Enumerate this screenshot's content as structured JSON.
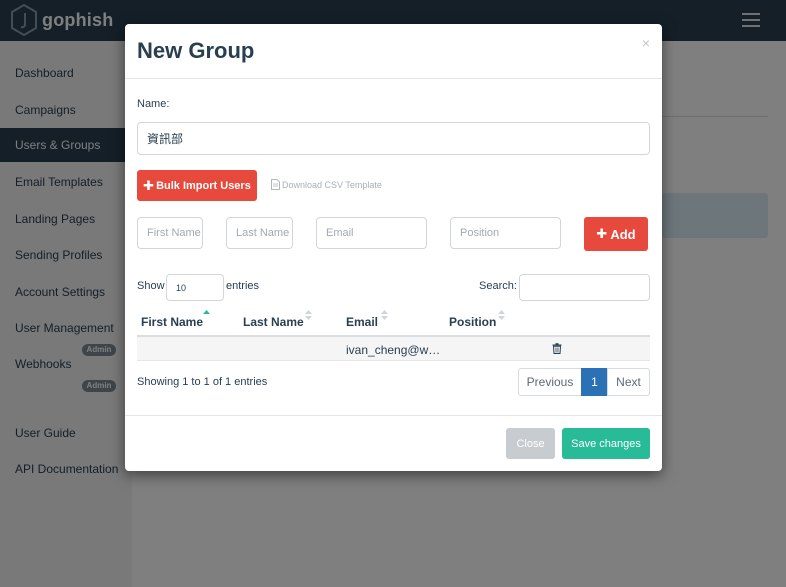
{
  "app": {
    "brand": "gophish"
  },
  "sidebar": {
    "items": [
      {
        "label": "Dashboard"
      },
      {
        "label": "Campaigns"
      },
      {
        "label": "Users & Groups"
      },
      {
        "label": "Email Templates"
      },
      {
        "label": "Landing Pages"
      },
      {
        "label": "Sending Profiles"
      },
      {
        "label": "Account Settings"
      },
      {
        "label": "User Management"
      },
      {
        "label": "Webhooks"
      },
      {
        "label": "User Guide"
      },
      {
        "label": "API Documentation"
      }
    ],
    "active": "Users & Groups",
    "badge": "Admin"
  },
  "modal": {
    "title": "New Group",
    "close": "×",
    "name_label": "Name:",
    "name_value": "資訊部",
    "bulk_import": "Bulk Import Users",
    "csv_template": "Download CSV Template",
    "fields": {
      "first_name_placeholder": "First Name",
      "last_name_placeholder": "Last Name",
      "email_placeholder": "Email",
      "position_placeholder": "Position"
    },
    "add_label": "Add",
    "show_label": "Show",
    "entries_value": "10",
    "entries_label": "entries",
    "search_label": "Search:",
    "table": {
      "columns": [
        "First Name",
        "Last Name",
        "Email",
        "Position"
      ],
      "rows": [
        {
          "first_name": "",
          "last_name": "",
          "email": "ivan_cheng@w…",
          "position": ""
        }
      ]
    },
    "info": "Showing 1 to 1 of 1 entries",
    "pagination": {
      "previous": "Previous",
      "page": "1",
      "next": "Next"
    },
    "footer": {
      "close": "Close",
      "save": "Save changes"
    }
  },
  "colors": {
    "navbar": "#283f50",
    "danger": "#e7493c",
    "primary": "#2a72b5",
    "success": "#27bb98",
    "disabled": "#c7ccd0"
  },
  "icons": [
    "gophish-logo-icon",
    "hamburger-menu-icon",
    "plus-icon",
    "file-icon",
    "sort-icon",
    "sort-asc-icon",
    "trash-icon",
    "close-icon"
  ]
}
